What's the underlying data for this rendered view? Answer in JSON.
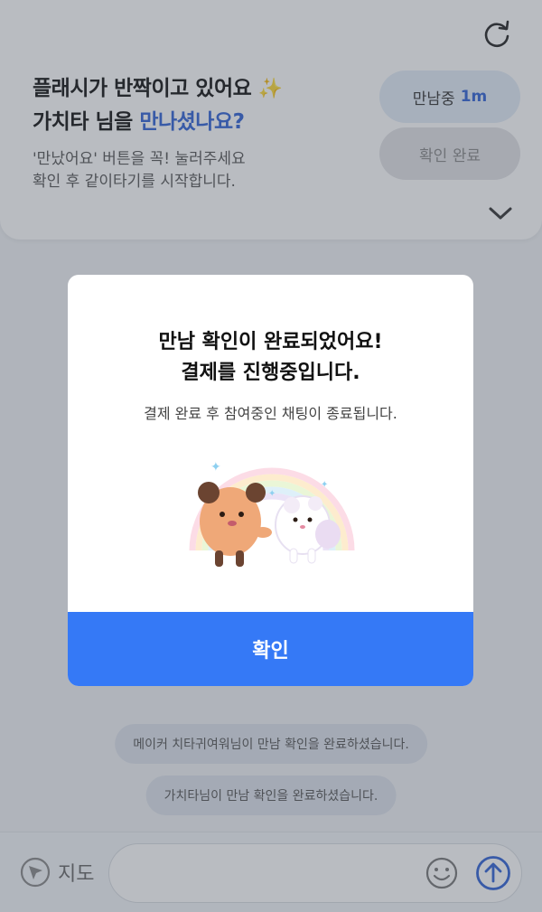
{
  "banner": {
    "title_line1": "플래시가 반짝이고 있어요",
    "sparkle": "✨",
    "title_line2_prefix": "가치타 님을 ",
    "title_line2_accent": "만나셨나요?",
    "sub_line1": "'만났어요' 버튼을 꼭! 눌러주세요",
    "sub_line2": "확인 후 같이타기를 시작합니다.",
    "meeting_label": "만남중",
    "meeting_time": "1m",
    "confirm_done_label": "확인 완료"
  },
  "messages": [
    "메이커 치타귀여워님이 만남 확인을 완료하셨습니다.",
    "가치타님이 만남 확인을 완료하셨습니다."
  ],
  "bottom": {
    "map_label": "지도",
    "input_placeholder": ""
  },
  "modal": {
    "title_line1": "만남 확인이 완료되었어요!",
    "title_line2": "결제를 진행중입니다.",
    "subtitle": "결제 완료 후 참여중인 채팅이 종료됩니다.",
    "confirm_button": "확인"
  },
  "colors": {
    "accent": "#2f62d6",
    "button": "#3579f6"
  },
  "icons": [
    "refresh-icon",
    "chevron-down-icon",
    "location-arrow-icon",
    "emoji-icon",
    "send-arrow-icon"
  ]
}
